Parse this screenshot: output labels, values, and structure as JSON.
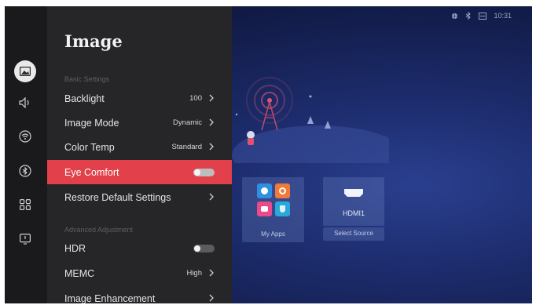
{
  "status_bar": {
    "time": "10:31"
  },
  "panel": {
    "title": "Image",
    "sections": {
      "basic": "Basic Settings",
      "advanced": "Advanced Adjustment"
    },
    "rows": {
      "backlight": {
        "label": "Backlight",
        "value": "100"
      },
      "image_mode": {
        "label": "Image Mode",
        "value": "Dynamic"
      },
      "color_temp": {
        "label": "Color Temp",
        "value": "Standard"
      },
      "eye_comfort": {
        "label": "Eye Comfort",
        "state": false
      },
      "restore": {
        "label": "Restore Default Settings"
      },
      "hdr": {
        "label": "HDR",
        "state": false
      },
      "memc": {
        "label": "MEMC",
        "value": "High"
      },
      "enhancement": {
        "label": "Image Enhancement"
      }
    }
  },
  "rail": {
    "items": [
      "image-icon",
      "sound-icon",
      "network-icon",
      "bluetooth-icon",
      "apps-grid-icon",
      "info-icon"
    ],
    "active": "image-icon"
  },
  "cards": {
    "my_apps": {
      "caption": "My Apps"
    },
    "hdmi": {
      "title": "HDMI1",
      "caption": "Select Source"
    }
  },
  "colors": {
    "highlight": "#e2404a",
    "panel_bg": "#262628",
    "rail_bg": "#1a1a1c",
    "background": "#1c2b6b"
  }
}
